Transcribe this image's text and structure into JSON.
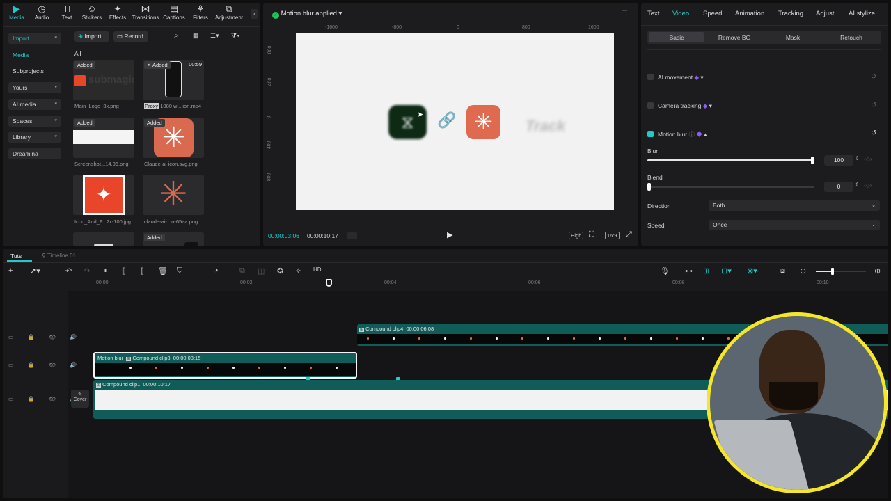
{
  "media_toolbar": [
    {
      "label": "Media",
      "icon": "media-icon",
      "active": true
    },
    {
      "label": "Audio",
      "icon": "audio-icon"
    },
    {
      "label": "Text",
      "icon": "text-icon"
    },
    {
      "label": "Stickers",
      "icon": "stickers-icon"
    },
    {
      "label": "Effects",
      "icon": "effects-icon"
    },
    {
      "label": "Transitions",
      "icon": "transitions-icon"
    },
    {
      "label": "Captions",
      "icon": "captions-icon"
    },
    {
      "label": "Filters",
      "icon": "filters-icon"
    },
    {
      "label": "Adjustment",
      "icon": "adjustment-icon"
    }
  ],
  "sidebar": {
    "items": [
      {
        "label": "Import"
      },
      {
        "label": "Media"
      },
      {
        "label": "Subprojects"
      },
      {
        "label": "Yours"
      },
      {
        "label": "AI media"
      },
      {
        "label": "Spaces"
      },
      {
        "label": "Library"
      },
      {
        "label": "Dreamina"
      }
    ]
  },
  "media": {
    "import_label": "Import",
    "record_label": "Record",
    "filter_label": "All",
    "items": [
      {
        "name": "Main_Logo_3x.png",
        "badge": "Added",
        "logo_text": "submagic"
      },
      {
        "name": "1080 wi...ion.mp4",
        "badge": "Added",
        "duration": "00:59",
        "proxy": "Proxy"
      },
      {
        "name": "Screenshot...14.36.png",
        "badge": "Added"
      },
      {
        "name": "Claude-ai-icon.svg.png",
        "badge": "Added"
      },
      {
        "name": "Icon_And_F...2x-100.jpg"
      },
      {
        "name": "claude-ai-...n-65aa.png"
      },
      {
        "name": ""
      },
      {
        "name": "",
        "badge": "Added"
      }
    ]
  },
  "player": {
    "title": "Motion blur applied",
    "status_color": "#22c55e",
    "ruler_h": [
      "-1600",
      "-800",
      "0",
      "800",
      "1600"
    ],
    "ruler_v": [
      "800",
      "400",
      "0",
      "-400",
      "-800"
    ],
    "current_time": "00:00:03:06",
    "total_time": "00:00:10:17",
    "quality": "High",
    "ratio": "16:9",
    "blur_text": "Track"
  },
  "props": {
    "tabs": [
      "Text",
      "Video",
      "Speed",
      "Animation",
      "Tracking",
      "Adjust",
      "AI stylize"
    ],
    "active_tab": "Video",
    "subtabs": [
      "Basic",
      "Remove BG",
      "Mask",
      "Retouch"
    ],
    "ai_movement": "AI movement",
    "camera_tracking": "Camera tracking",
    "motion_blur": "Motion blur",
    "blur_label": "Blur",
    "blur_value": "100",
    "blur_fraction": 1.0,
    "blend_label": "Blend",
    "blend_value": "0",
    "blend_fraction": 0.0,
    "direction_label": "Direction",
    "direction_value": "Both",
    "speed_label": "Speed",
    "speed_value": "Once"
  },
  "timeline": {
    "project_tab": "Tuts",
    "timeline_tab": "Timeline 01",
    "ruler": [
      "00:00",
      "00:02",
      "00:04",
      "00:06",
      "00:08",
      "00:10"
    ],
    "cover_label": "Cover",
    "clip4": {
      "name": "Compound clip4",
      "duration": "00:00:06:08"
    },
    "clip3": {
      "effect": "Motion blur",
      "name": "Compound clip3",
      "duration": "00:00:03:15"
    },
    "clip1": {
      "name": "Compound clip1",
      "duration": "00:00:10:17"
    },
    "track_color": "#0f5c58",
    "accent": "#21c9c9"
  }
}
